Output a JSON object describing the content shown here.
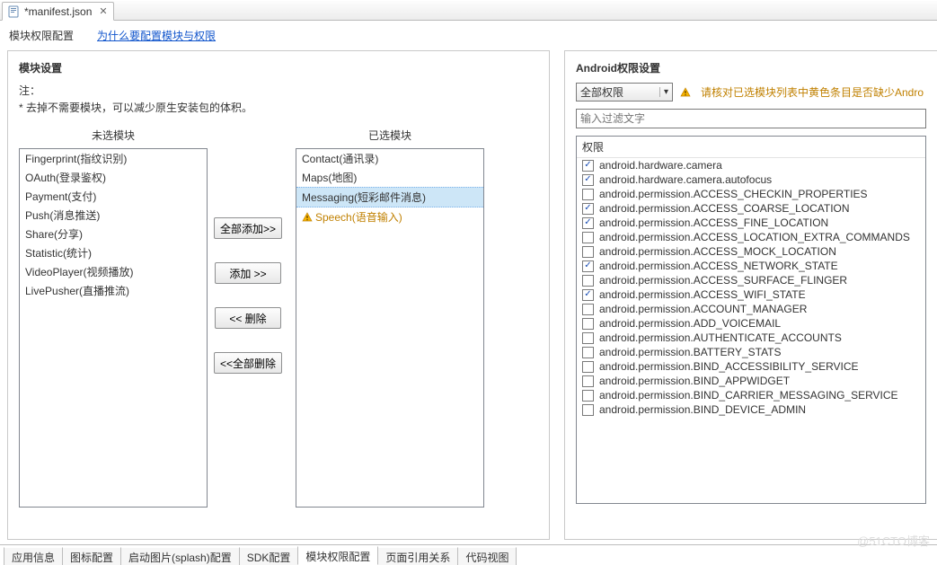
{
  "tab": {
    "filename": "*manifest.json"
  },
  "subheader": {
    "title": "模块权限配置",
    "link": "为什么要配置模块与权限"
  },
  "leftPanel": {
    "title": "模块设置",
    "noteLabel": "注：",
    "note1": "* 去掉不需要模块，可以减少原生安装包的体积。",
    "unselectedTitle": "未选模块",
    "selectedTitle": "已选模块",
    "unselected": [
      "Fingerprint(指纹识别)",
      "OAuth(登录鉴权)",
      "Payment(支付)",
      "Push(消息推送)",
      "Share(分享)",
      "Statistic(统计)",
      "VideoPlayer(视频播放)",
      "LivePusher(直播推流)"
    ],
    "selected": [
      {
        "label": "Contact(通讯录)",
        "state": ""
      },
      {
        "label": "Maps(地图)",
        "state": ""
      },
      {
        "label": "Messaging(短彩邮件消息)",
        "state": "selected"
      },
      {
        "label": "Speech(语音输入)",
        "state": "warn"
      }
    ],
    "buttons": {
      "addAll": "全部添加>>",
      "add": "添加  >>",
      "remove": "<<  删除",
      "removeAll": "<<全部删除"
    }
  },
  "rightPanel": {
    "title": "Android权限设置",
    "dropdown": "全部权限",
    "warning": "请核对已选模块列表中黄色条目是否缺少Andro",
    "filterPlaceholder": "输入过滤文字",
    "permHeader": "权限",
    "permissions": [
      {
        "label": "android.hardware.camera",
        "checked": true
      },
      {
        "label": "android.hardware.camera.autofocus",
        "checked": true
      },
      {
        "label": "android.permission.ACCESS_CHECKIN_PROPERTIES",
        "checked": false
      },
      {
        "label": "android.permission.ACCESS_COARSE_LOCATION",
        "checked": true
      },
      {
        "label": "android.permission.ACCESS_FINE_LOCATION",
        "checked": true
      },
      {
        "label": "android.permission.ACCESS_LOCATION_EXTRA_COMMANDS",
        "checked": false
      },
      {
        "label": "android.permission.ACCESS_MOCK_LOCATION",
        "checked": false
      },
      {
        "label": "android.permission.ACCESS_NETWORK_STATE",
        "checked": true
      },
      {
        "label": "android.permission.ACCESS_SURFACE_FLINGER",
        "checked": false
      },
      {
        "label": "android.permission.ACCESS_WIFI_STATE",
        "checked": true
      },
      {
        "label": "android.permission.ACCOUNT_MANAGER",
        "checked": false
      },
      {
        "label": "android.permission.ADD_VOICEMAIL",
        "checked": false
      },
      {
        "label": "android.permission.AUTHENTICATE_ACCOUNTS",
        "checked": false
      },
      {
        "label": "android.permission.BATTERY_STATS",
        "checked": false
      },
      {
        "label": "android.permission.BIND_ACCESSIBILITY_SERVICE",
        "checked": false
      },
      {
        "label": "android.permission.BIND_APPWIDGET",
        "checked": false
      },
      {
        "label": "android.permission.BIND_CARRIER_MESSAGING_SERVICE",
        "checked": false
      },
      {
        "label": "android.permission.BIND_DEVICE_ADMIN",
        "checked": false
      }
    ]
  },
  "bottomTabs": {
    "items": [
      "应用信息",
      "图标配置",
      "启动图片(splash)配置",
      "SDK配置",
      "模块权限配置",
      "页面引用关系",
      "代码视图"
    ],
    "activeIndex": 4
  },
  "watermark": "@51CTO博客"
}
